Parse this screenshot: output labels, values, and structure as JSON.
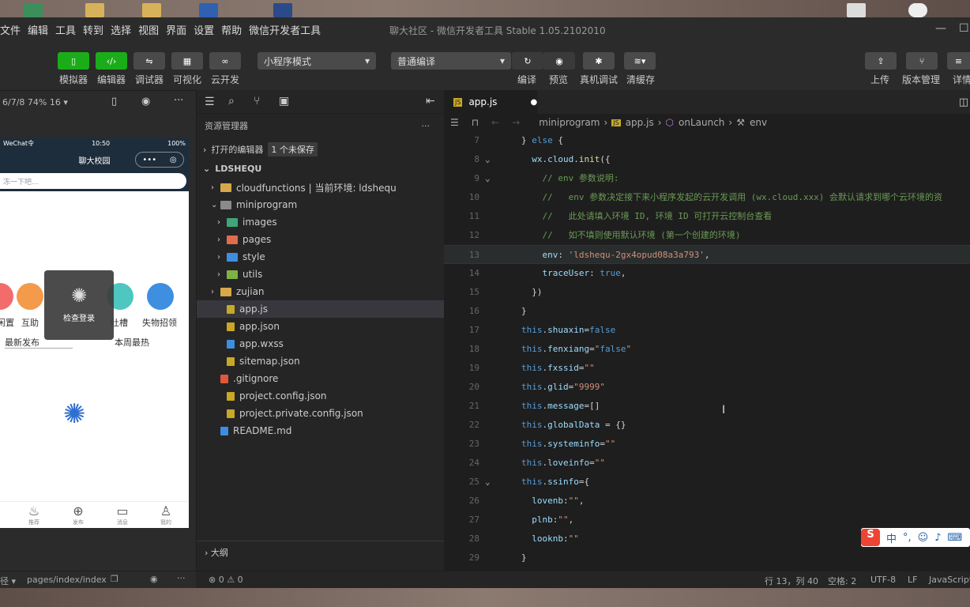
{
  "window": {
    "title": "聊大社区 - 微信开发者工具 Stable 1.05.2102010"
  },
  "menu": [
    "文件",
    "编辑",
    "工具",
    "转到",
    "选择",
    "视图",
    "界面",
    "设置",
    "帮助",
    "微信开发者工具"
  ],
  "toolbar": {
    "left": [
      {
        "label": "模拟器",
        "icon": "phone-icon"
      },
      {
        "label": "编辑器",
        "icon": "code-icon"
      },
      {
        "label": "调试器",
        "icon": "debug-icon"
      },
      {
        "label": "可视化",
        "icon": "layout-icon"
      },
      {
        "label": "云开发",
        "icon": "cloud-icon"
      }
    ],
    "mode_select": "小程序模式",
    "compile_select": "普通编译",
    "mid": [
      {
        "label": "编译",
        "icon": "refresh-icon"
      },
      {
        "label": "预览",
        "icon": "eye-icon"
      },
      {
        "label": "真机调试",
        "icon": "bug-icon"
      },
      {
        "label": "清缓存",
        "icon": "layers-icon"
      }
    ],
    "right": [
      {
        "label": "上传",
        "icon": "upload-icon"
      },
      {
        "label": "版本管理",
        "icon": "branch-icon"
      },
      {
        "label": "详情",
        "icon": "menu-icon"
      }
    ]
  },
  "simulator": {
    "device": "6/7/8 74% 16 ▾",
    "status_left": "WeChat令",
    "status_time": "10:50",
    "status_battery": "100%",
    "nav_title": "聊大校园",
    "search_placeholder": "冻一下吧...",
    "categories": [
      {
        "label": "闲置",
        "color": "#f36c6c"
      },
      {
        "label": "互助",
        "color": "#f39a4b"
      },
      {
        "label": "吐槽",
        "color": "#4dc7c0"
      },
      {
        "label": "失物招领",
        "color": "#3e8fe0"
      }
    ],
    "toast_text": "检查登录",
    "section_left": "最新发布",
    "section_right": "本周最热",
    "tabbar": [
      {
        "label": "推荐",
        "icon": "fire-icon"
      },
      {
        "label": "发布",
        "icon": "plus-icon"
      },
      {
        "label": "消息",
        "icon": "message-icon"
      },
      {
        "label": "我的",
        "icon": "user-icon"
      }
    ],
    "footer_path": "pages/index/index",
    "footer_left": "径 ▾"
  },
  "explorer": {
    "title": "资源管理器",
    "open_editors": "打开的编辑器",
    "unsaved": "1 个未保存",
    "project": "LDSHEQU",
    "tree": [
      {
        "name": "cloudfunctions | 当前环境: ldshequ",
        "type": "folder"
      },
      {
        "name": "miniprogram",
        "type": "folder-open"
      },
      {
        "name": "images",
        "type": "folder-img"
      },
      {
        "name": "pages",
        "type": "folder-pages"
      },
      {
        "name": "style",
        "type": "folder-style"
      },
      {
        "name": "utils",
        "type": "folder-utils"
      },
      {
        "name": "zujian",
        "type": "folder"
      },
      {
        "name": "app.js",
        "type": "js"
      },
      {
        "name": "app.json",
        "type": "json"
      },
      {
        "name": "app.wxss",
        "type": "wxss"
      },
      {
        "name": "sitemap.json",
        "type": "json"
      },
      {
        "name": ".gitignore",
        "type": "git"
      },
      {
        "name": "project.config.json",
        "type": "json"
      },
      {
        "name": "project.private.config.json",
        "type": "json"
      },
      {
        "name": "README.md",
        "type": "info"
      }
    ],
    "outline": "大纲"
  },
  "editor": {
    "tab": "app.js",
    "breadcrumb": [
      "miniprogram",
      "app.js",
      "onLaunch",
      "env"
    ],
    "lines": [
      {
        "n": "7",
        "t": "} else {"
      },
      {
        "n": "8",
        "t": "  wx.cloud.init({"
      },
      {
        "n": "9",
        "t": "    // env 参数说明:"
      },
      {
        "n": "10",
        "t": "    //   env 参数决定接下来小程序发起的云开发调用 (wx.cloud.xxx) 会默认请求到哪个云环境的资"
      },
      {
        "n": "11",
        "t": "    //   此处请填入环境 ID, 环境 ID 可打开云控制台查看"
      },
      {
        "n": "12",
        "t": "    //   如不填则使用默认环境 (第一个创建的环境)"
      },
      {
        "n": "13",
        "t": "    env: 'ldshequ-2gx4opud08a3a793',"
      },
      {
        "n": "14",
        "t": "    traceUser: true,"
      },
      {
        "n": "15",
        "t": "  })"
      },
      {
        "n": "16",
        "t": "}"
      },
      {
        "n": "17",
        "t": "this.shuaxin=false"
      },
      {
        "n": "18",
        "t": "this.fenxiang=\"false\""
      },
      {
        "n": "19",
        "t": "this.fxssid=\"\""
      },
      {
        "n": "20",
        "t": "this.glid=\"9999\""
      },
      {
        "n": "21",
        "t": "this.message=[]"
      },
      {
        "n": "22",
        "t": "this.globalData = {}"
      },
      {
        "n": "23",
        "t": "this.systeminfo=\"\""
      },
      {
        "n": "24",
        "t": "this.loveinfo=\"\""
      },
      {
        "n": "25",
        "t": "this.ssinfo={"
      },
      {
        "n": "26",
        "t": "  lovenb:\"\","
      },
      {
        "n": "27",
        "t": "  plnb:\"\","
      },
      {
        "n": "28",
        "t": "  looknb:\"\""
      },
      {
        "n": "29",
        "t": "}"
      }
    ]
  },
  "statusbar": {
    "errors": "⊗ 0 ⚠ 0",
    "position": "行 13，列 40",
    "indent": "空格: 2",
    "encoding": "UTF-8",
    "eol": "LF",
    "lang": "JavaScript"
  },
  "ime": {
    "label": "中"
  }
}
